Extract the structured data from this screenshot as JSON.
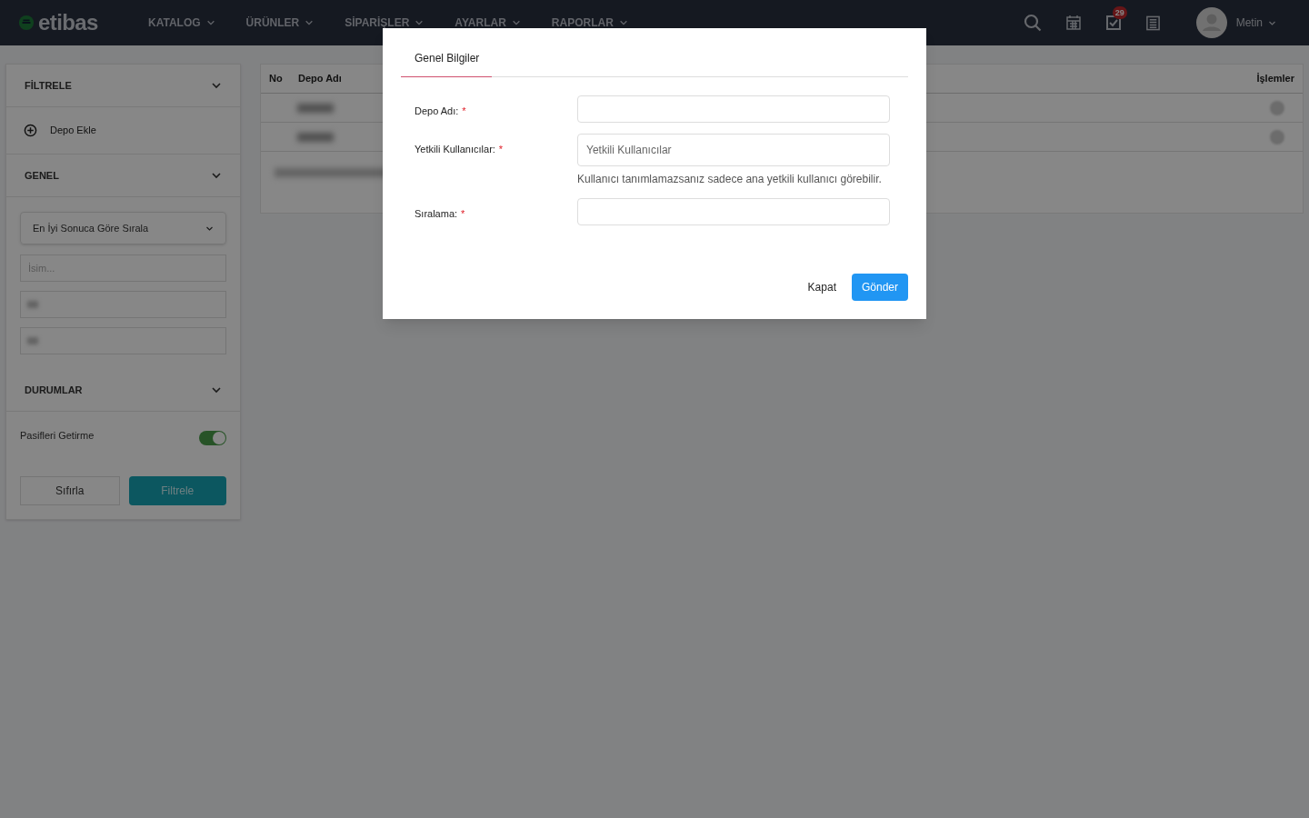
{
  "navbar": {
    "logo": "etibas",
    "menu": [
      {
        "label": "KATALOG"
      },
      {
        "label": "ÜRÜNLER"
      },
      {
        "label": "SİPARİŞLER"
      },
      {
        "label": "AYARLAR"
      },
      {
        "label": "RAPORLAR"
      }
    ],
    "task_badge": "29",
    "user": "Metin"
  },
  "sidebar": {
    "filter_title": "FİLTRELE",
    "add_button": "Depo Ekle",
    "general_title": "GENEL",
    "sort_value": "En İyi Sonuca Göre Sırala",
    "fields": [
      {
        "placeholder": "İsim...",
        "blurred": false
      },
      {
        "blurred": true
      },
      {
        "blurred": true
      }
    ],
    "status_title": "DURUMLAR",
    "toggle": {
      "label": "Pasifleri Getirme",
      "on": true
    },
    "reset_button": "Sıfırla",
    "filter_button": "Filtrele"
  },
  "table": {
    "columns": [
      "No",
      "Depo Adı",
      "İşlemler"
    ],
    "rows": [
      {
        "blurred": true
      },
      {
        "blurred": true
      }
    ],
    "footer_blurred": true
  },
  "modal": {
    "tabs": [
      {
        "label": "Genel Bilgiler",
        "selected": true
      }
    ],
    "fields": [
      {
        "label": "Depo Adı:",
        "required_mark": "*"
      },
      {
        "label": "Yetkili Kullanıcılar:",
        "required_mark": "*",
        "placeholder": "Yetkili Kullanıcılar",
        "hint": "Kullanıcı tanımlamazsanız sadece ana yetkili kullanıcı görebilir."
      },
      {
        "label": "Sıralama:",
        "required_mark": "*"
      }
    ],
    "close_button": "Kapat",
    "submit_button": "Gönder"
  }
}
